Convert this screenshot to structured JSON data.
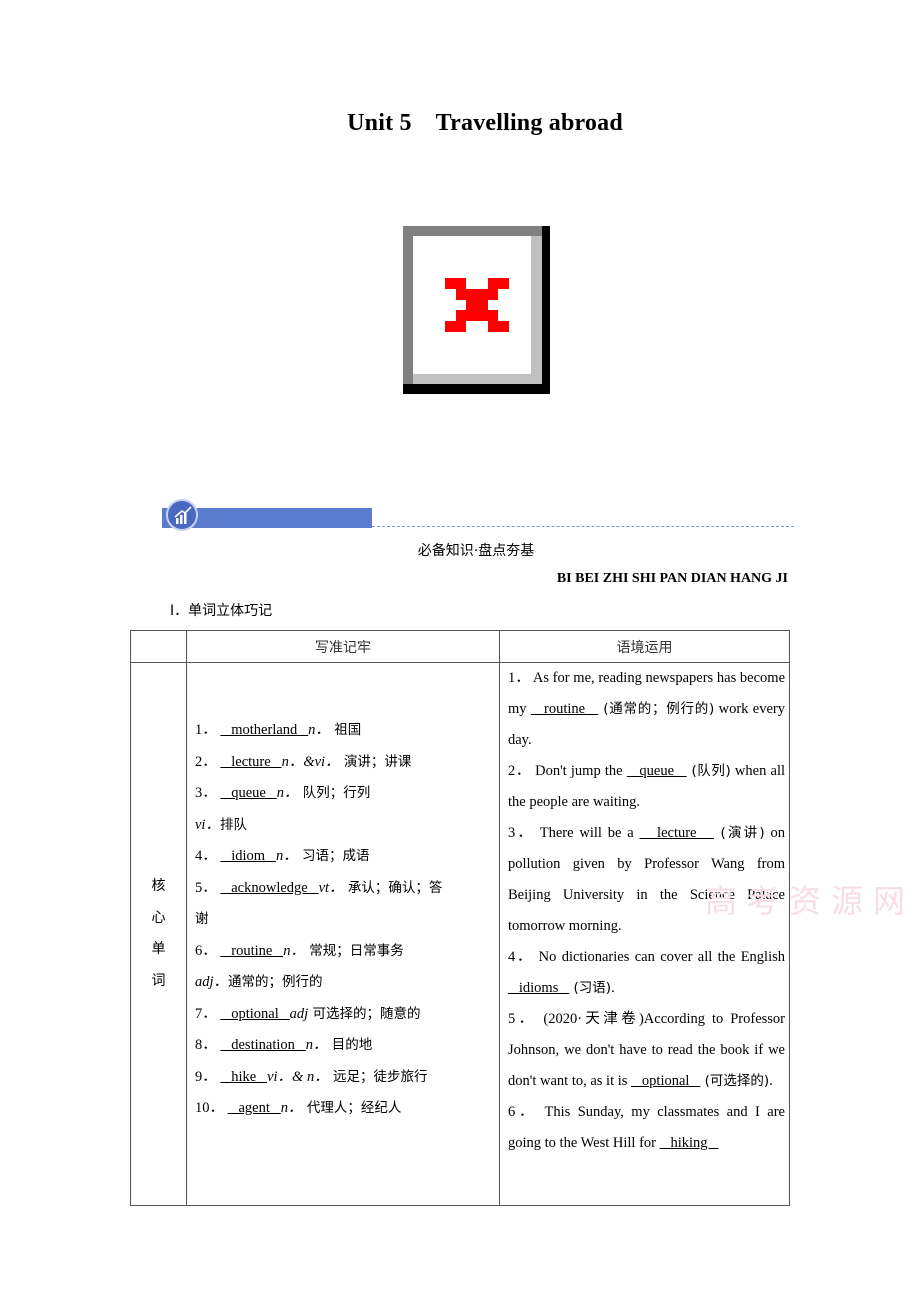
{
  "document": {
    "title_unit": "Unit 5",
    "title_name": "Travelling abroad",
    "broken_image_icon": "broken-image-icon",
    "section_icon": "chart-growth-icon",
    "section_title_cn": "必备知识·盘点夯基",
    "section_title_pinyin": "BI BEI ZHI SHI PAN DIAN HANG JI",
    "part_title": "Ⅰ．单词立体巧记",
    "watermark": "高考资源网"
  },
  "table": {
    "headers": [
      "",
      "写准记牢",
      "语境运用"
    ],
    "side_label": [
      "核",
      "心",
      "单",
      "词"
    ],
    "words": [
      {
        "num": "1．",
        "word": "motherland",
        "pos": "n．",
        "meaning": "祖国"
      },
      {
        "num": "2．",
        "word": "lecture",
        "pos": "n．&vi．",
        "meaning": "演讲；讲课"
      },
      {
        "num": "3．",
        "word": "queue",
        "pos": "n．",
        "meaning": "队列；行列",
        "extra_pos": "vi．",
        "extra_meaning": "排队"
      },
      {
        "num": "4．",
        "word": "idiom",
        "pos": "n．",
        "meaning": "习语；成语"
      },
      {
        "num": "5．",
        "word": "acknowledge",
        "pos": "vt．",
        "meaning": "承认；确认；答",
        "meaning_cont": "谢"
      },
      {
        "num": "6．",
        "word": "routine",
        "pos": "n．",
        "meaning": "常规；日常事务",
        "extra_pos": "adj．",
        "extra_meaning": "通常的；例行的"
      },
      {
        "num": "7．",
        "word": "optional",
        "pos": "adj",
        "meaning": "可选择的；随意的"
      },
      {
        "num": "8．",
        "word": "destination",
        "pos": "n．",
        "meaning": "目的地"
      },
      {
        "num": "9．",
        "word": "hike",
        "pos": "vi．& n．",
        "meaning": "远足；徒步旅行"
      },
      {
        "num": "10．",
        "word": "agent",
        "pos": "n．",
        "meaning": "代理人；经纪人"
      }
    ],
    "usage": [
      {
        "num": "1．",
        "before": "As for me, reading newspapers has become my ",
        "answer": "routine",
        "hint": "(通常的；例行的)",
        "after": " work every day."
      },
      {
        "num": "2．",
        "before": "Don't jump the ",
        "answer": "queue",
        "hint": "(队列)",
        "after": " when all the people  are waiting."
      },
      {
        "num": "3．",
        "before": "There will be a ",
        "answer": "lecture",
        "hint": "(演讲)",
        "after": " on pollution given by Professor Wang from Beijing University in the Science Palace tomorrow morning."
      },
      {
        "num": "4．",
        "before": "No dictionaries can cover all the English ",
        "answer": "idioms",
        "hint": "(习语)",
        "after": "."
      },
      {
        "num": "5．",
        "before": "(2020·天津卷)According to Professor Johnson, we don't have to read the book if we don't want to, as it is ",
        "answer": "optional",
        "hint": "(可选择的)",
        "after": "."
      },
      {
        "num": "6．",
        "before": "This Sunday, my classmates and I are going to the West Hill for ",
        "answer": "hiking",
        "hint": "",
        "after": ""
      }
    ]
  }
}
